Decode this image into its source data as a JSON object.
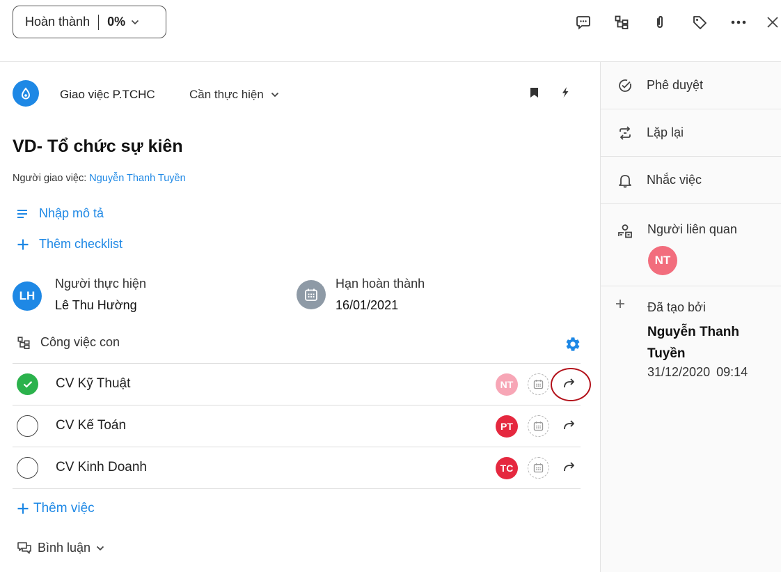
{
  "status": {
    "label": "Hoàn thành",
    "percent": "0%"
  },
  "project": {
    "name": "Giao việc P.TCHC",
    "phase": "Cần thực hiện"
  },
  "task": {
    "title": "VD- Tổ chức sự kiên",
    "assigner_label": "Người giao việc:",
    "assigner_name": "Nguyễn Thanh Tuyền",
    "description_link": "Nhập mô tả",
    "checklist_link": "Thêm checklist"
  },
  "assignee": {
    "label": "Người thực hiện",
    "name": "Lê Thu Hường",
    "initials": "LH",
    "color": "#1e88e5"
  },
  "deadline": {
    "label": "Hạn hoàn thành",
    "date": "16/01/2021"
  },
  "subtasks": {
    "header": "Công việc con",
    "items": [
      {
        "name": "CV Kỹ Thuật",
        "done": true,
        "initials": "NT",
        "color": "#f7a6b6"
      },
      {
        "name": "CV Kế Toán",
        "done": false,
        "initials": "PT",
        "color": "#e5283f"
      },
      {
        "name": "CV Kinh Doanh",
        "done": false,
        "initials": "TC",
        "color": "#e5283f"
      }
    ],
    "add_label": "Thêm việc"
  },
  "comments": {
    "label": "Bình luận"
  },
  "sidebar": {
    "approve": "Phê duyệt",
    "repeat": "Lặp lại",
    "reminder": "Nhắc việc",
    "related_title": "Người liên quan",
    "related_initials": "NT",
    "created_label": "Đã tạo bởi",
    "created_by": "Nguyễn Thanh Tuyền",
    "created_at": "31/12/2020 09:14"
  },
  "colors": {
    "accent": "#1e88e5",
    "done": "#2bb24c",
    "highlight": "#b3121b"
  }
}
